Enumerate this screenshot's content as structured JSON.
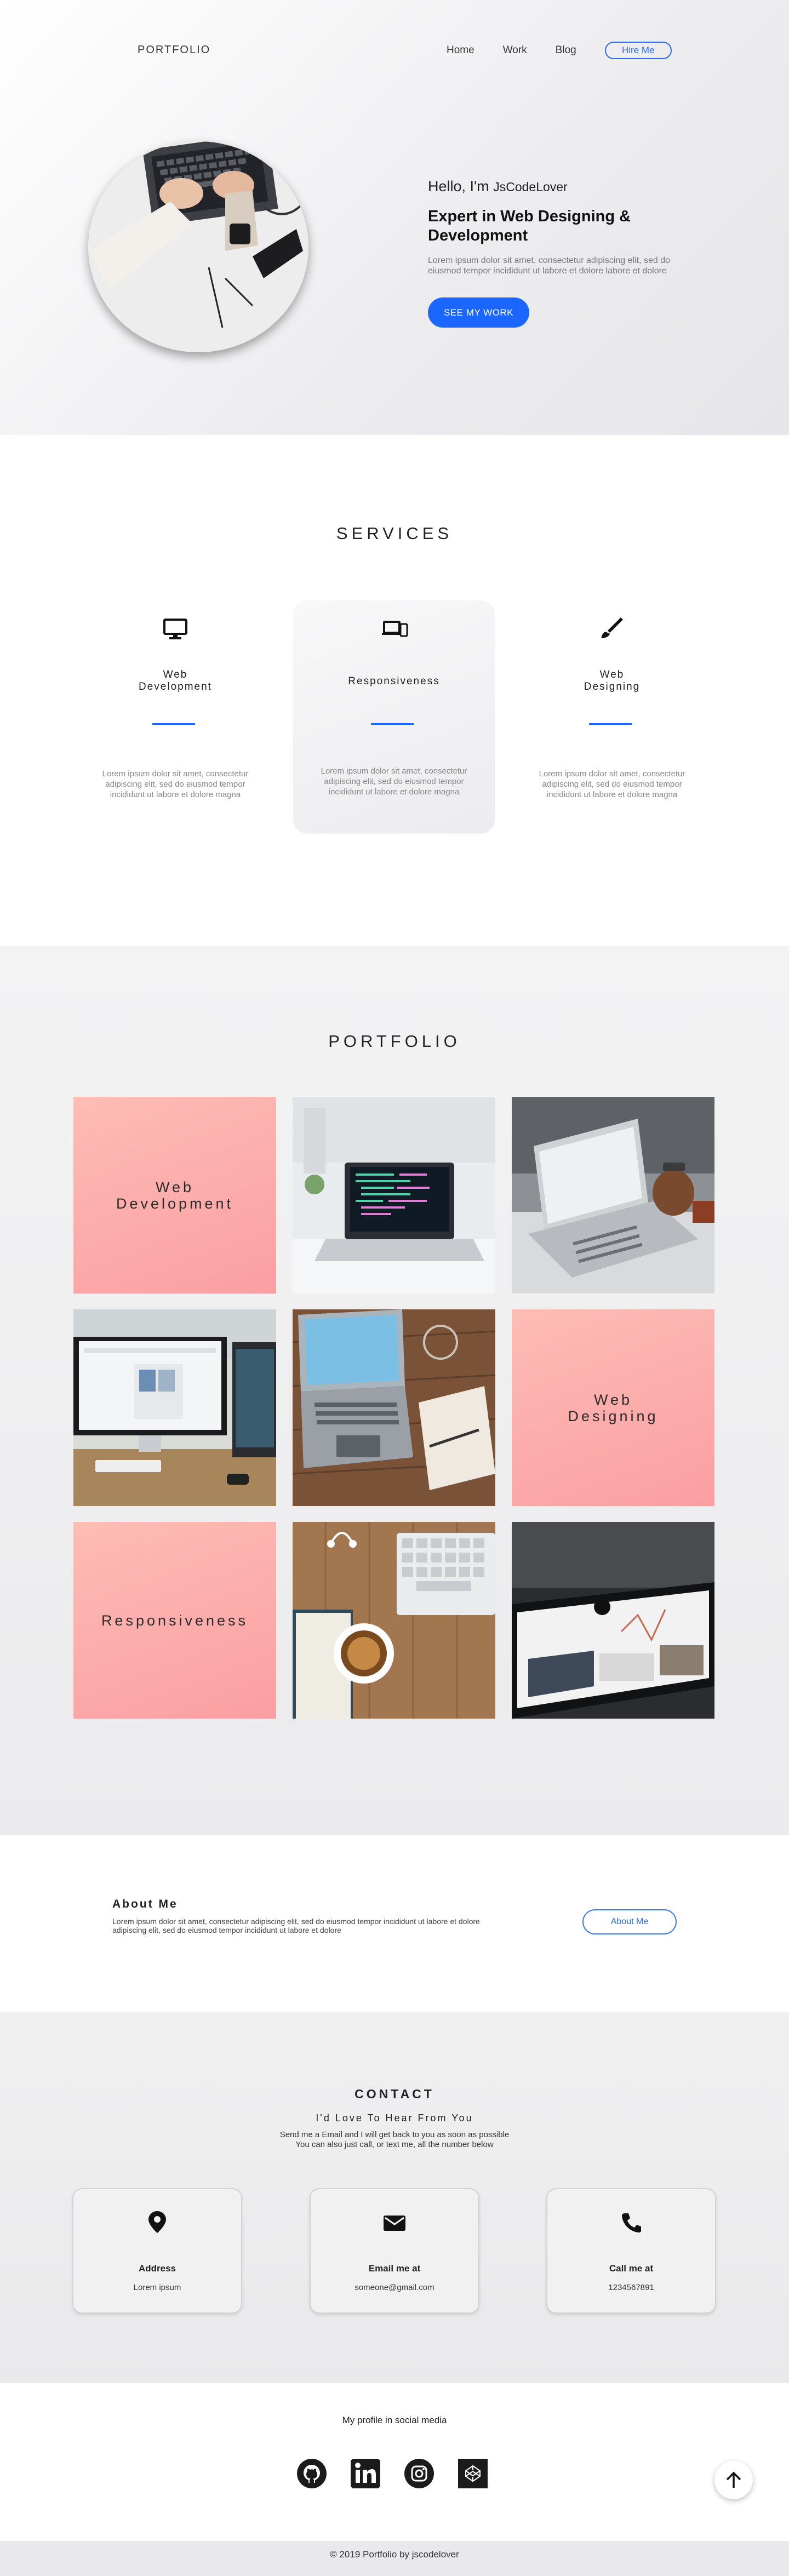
{
  "header": {
    "logo": "PORTFOLIO",
    "nav": [
      "Home",
      "Work",
      "Blog"
    ],
    "hire_label": "Hire Me"
  },
  "hero": {
    "hello": "Hello, I'm",
    "name": "JsCodeLover",
    "expert": "Expert in Web Designing & Development",
    "desc": "Lorem ipsum dolor sit amet, consectetur adipiscing elit, sed do eiusmod tempor incididunt ut labore et dolore labore et dolore",
    "cta": "SEE MY WORK"
  },
  "services": {
    "title": "SERVICES",
    "items": [
      {
        "title": "Web\nDevelopment",
        "icon": "monitor-icon",
        "desc": "Lorem ipsum dolor sit amet, consectetur adipiscing elit, sed do eiusmod tempor incididunt ut labore et dolore magna"
      },
      {
        "title": "Responsiveness",
        "icon": "devices-icon",
        "desc": "Lorem ipsum dolor sit amet, consectetur adipiscing elit, sed do eiusmod tempor incididunt ut labore et dolore magna"
      },
      {
        "title": "Web\nDesigning",
        "icon": "brush-icon",
        "desc": "Lorem ipsum dolor sit amet, consectetur adipiscing elit, sed do eiusmod tempor incididunt ut labore et dolore magna"
      }
    ]
  },
  "portfolio": {
    "title": "PORTFOLIO",
    "labels": {
      "web_dev": "Web\nDevelopment",
      "web_design": "Web\nDesigning",
      "responsive": "Responsiveness"
    }
  },
  "about": {
    "title": "About Me",
    "desc": "Lorem ipsum dolor sit amet, consectetur adipiscing elit, sed do eiusmod tempor incididunt ut labore et dolore adipiscing elit, sed do eiusmod tempor incididunt ut labore et dolore",
    "button": "About Me"
  },
  "contact": {
    "title": "CONTACT",
    "subtitle": "I'd Love To Hear From You",
    "desc_line1": "Send me a Email and I will get back to you as soon as possible",
    "desc_line2": "You can also just call, or text me, all the number below",
    "cards": [
      {
        "icon": "location-pin-icon",
        "label": "Address",
        "value": "Lorem ipsum"
      },
      {
        "icon": "mail-icon",
        "label": "Email me at",
        "value": "someone@gmail.com"
      },
      {
        "icon": "phone-icon",
        "label": "Call me at",
        "value": "1234567891"
      }
    ]
  },
  "footer": {
    "social_title": "My profile in social media",
    "social_icons": [
      "github-icon",
      "linkedin-icon",
      "instagram-icon",
      "codepen-icon"
    ],
    "copyright": "© 2019 Portfolio by jscodelover"
  },
  "colors": {
    "accent": "#1b66ff",
    "pink_tile": "#fca9a8"
  }
}
